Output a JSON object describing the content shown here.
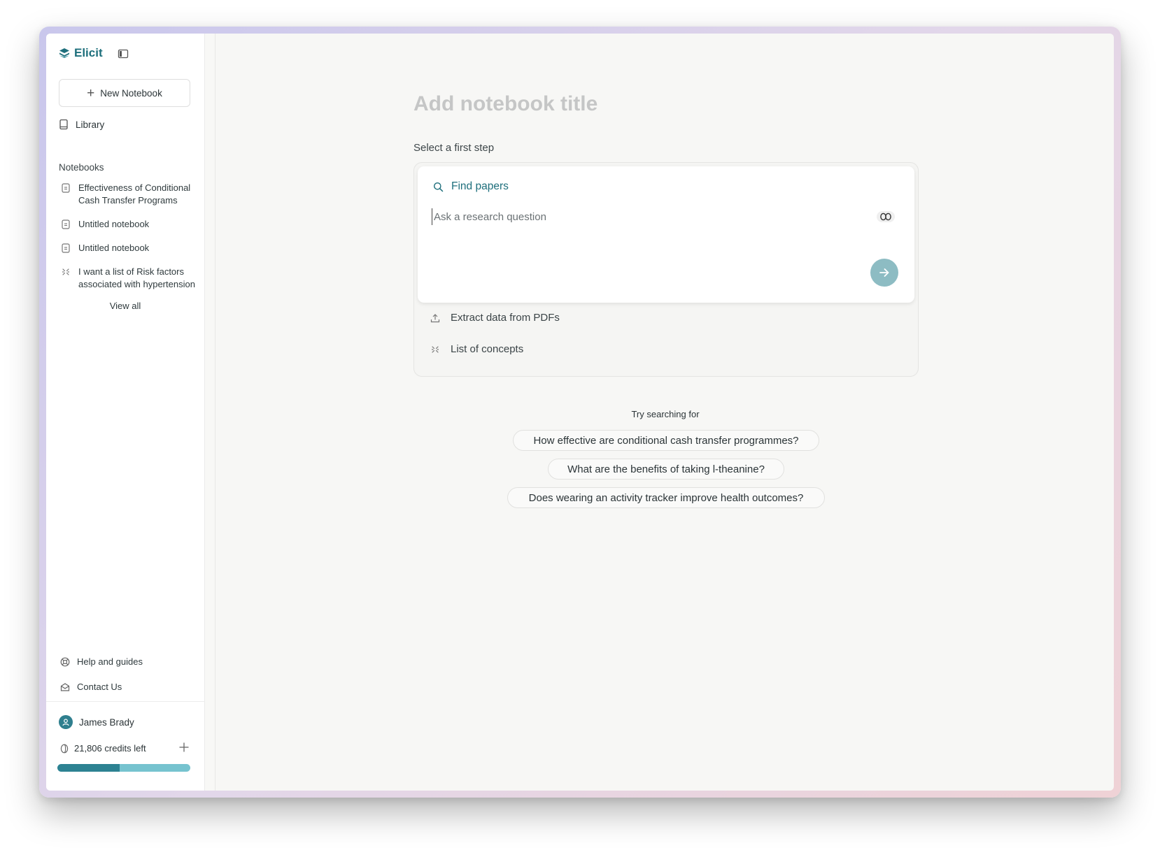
{
  "brand": {
    "name": "Elicit"
  },
  "sidebar": {
    "new_notebook_label": "New Notebook",
    "library_label": "Library",
    "notebooks_heading": "Notebooks",
    "notebooks": [
      {
        "title": "Effectiveness of Conditional Cash Transfer Programs",
        "icon": "notebook-icon"
      },
      {
        "title": "Untitled notebook",
        "icon": "notebook-icon"
      },
      {
        "title": "Untitled notebook",
        "icon": "notebook-icon"
      },
      {
        "title": "I want a list of Risk factors associated with hypertension",
        "icon": "concepts-icon"
      }
    ],
    "view_all_label": "View all",
    "help_label": "Help and guides",
    "contact_label": "Contact Us",
    "user_name": "James Brady",
    "credits_text": "21,806 credits left",
    "credits_used_fraction": 0.47
  },
  "main": {
    "title_placeholder": "Add notebook title",
    "select_step_label": "Select a first step",
    "find_papers_label": "Find papers",
    "question_placeholder": "Ask a research question",
    "options": [
      {
        "label": "Extract data from PDFs",
        "icon": "upload-icon"
      },
      {
        "label": "List of concepts",
        "icon": "concepts-icon"
      }
    ],
    "try_label": "Try searching for",
    "suggestions": [
      "How effective are conditional cash transfer programmes?",
      "What are the benefits of taking l-theanine?",
      "Does wearing an activity tracker improve health outcomes?"
    ]
  },
  "colors": {
    "brand": "#1e6f7c",
    "submit_button": "#8dbcc3",
    "progress_fill": "#2d8292",
    "progress_track": "#76c3cf"
  }
}
